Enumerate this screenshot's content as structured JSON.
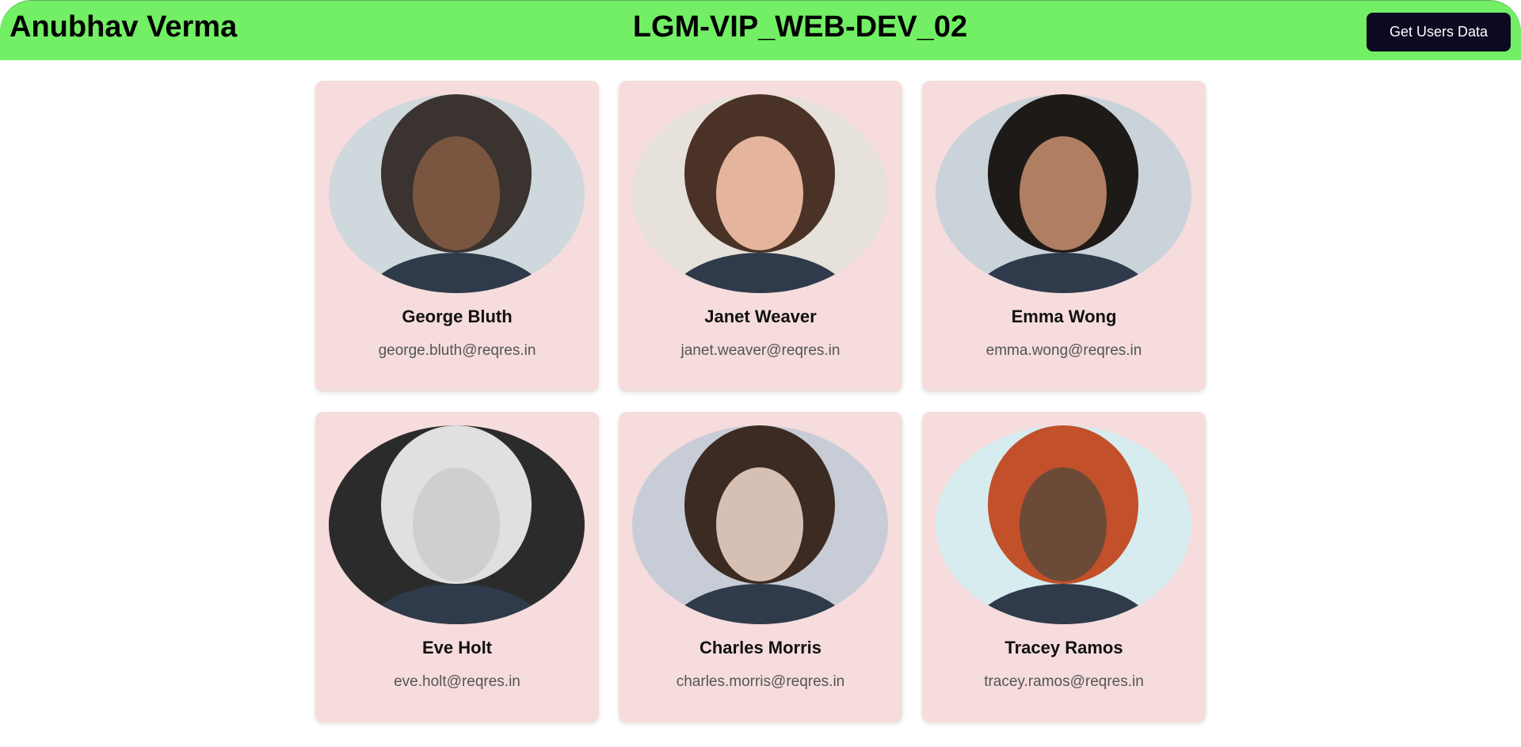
{
  "header": {
    "brand": "Anubhav Verma",
    "title": "LGM-VIP_WEB-DEV_02",
    "button_label": "Get Users Data",
    "bg_color": "#72ef65"
  },
  "users": [
    {
      "name": "George Bluth",
      "email": "george.bluth@reqres.in",
      "bg": "#cfd8dc",
      "face": "#7a5640",
      "hair": "#3a3330"
    },
    {
      "name": "Janet Weaver",
      "email": "janet.weaver@reqres.in",
      "bg": "#e6e1da",
      "face": "#e4b59c",
      "hair": "#4a3226"
    },
    {
      "name": "Emma Wong",
      "email": "emma.wong@reqres.in",
      "bg": "#c9d3d9",
      "face": "#b07e62",
      "hair": "#1e1a18"
    },
    {
      "name": "Eve Holt",
      "email": "eve.holt@reqres.in",
      "bg": "#2b2b2b",
      "face": "#cfcfcf",
      "hair": "#e0e0e0"
    },
    {
      "name": "Charles Morris",
      "email": "charles.morris@reqres.in",
      "bg": "#c8ccd6",
      "face": "#d6c0b4",
      "hair": "#3c2b22"
    },
    {
      "name": "Tracey Ramos",
      "email": "tracey.ramos@reqres.in",
      "bg": "#d6ecef",
      "face": "#6b4a37",
      "hair": "#c2502a"
    }
  ]
}
